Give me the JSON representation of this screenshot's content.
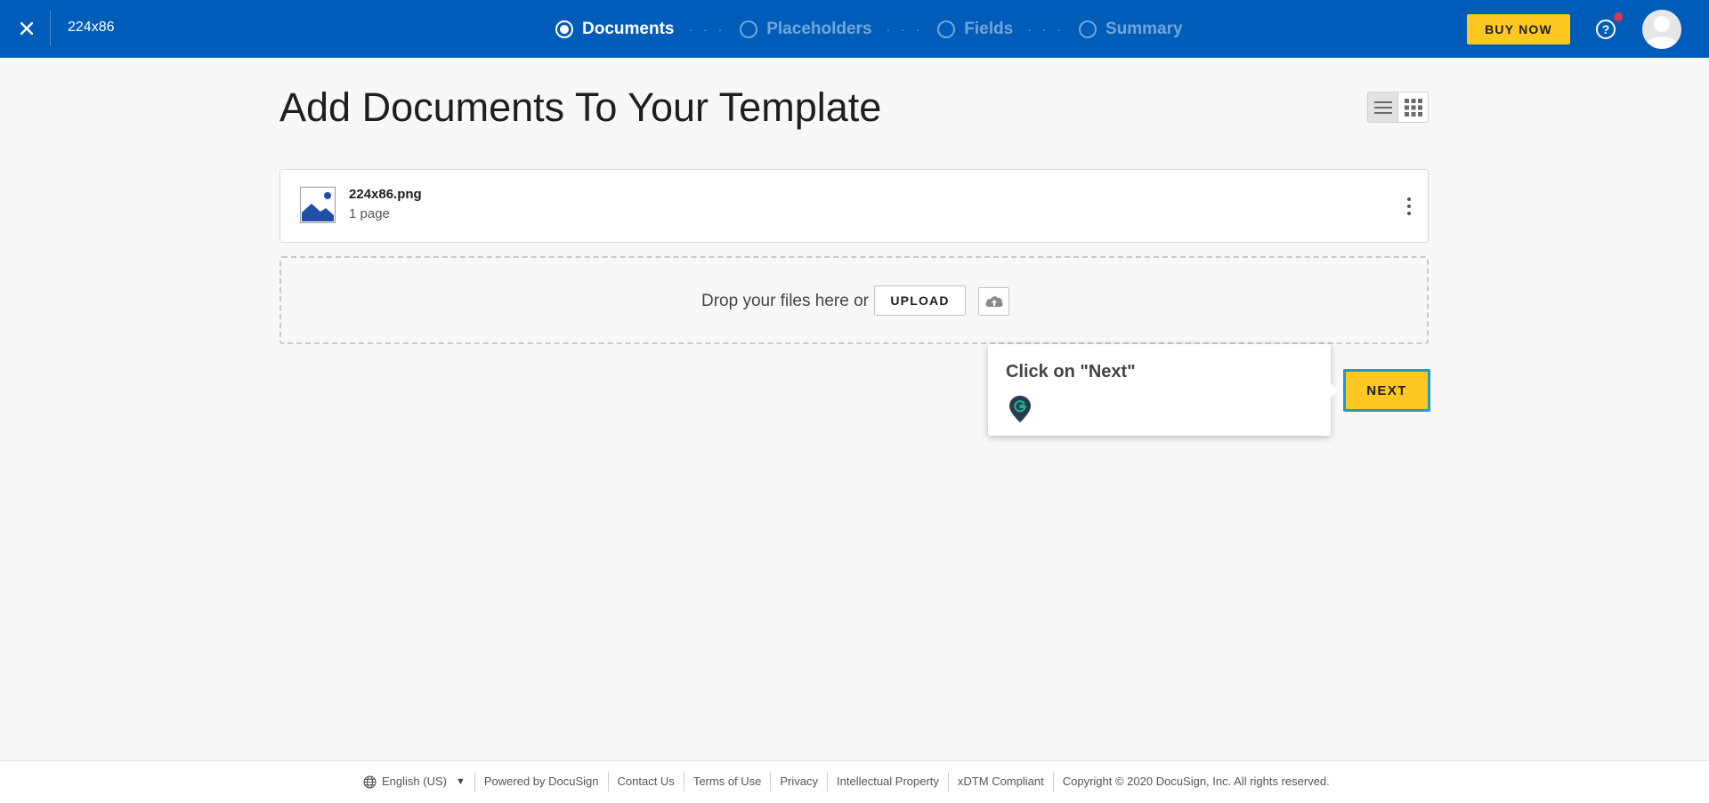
{
  "header": {
    "document_title": "224x86",
    "steps": [
      {
        "label": "Documents",
        "active": true
      },
      {
        "label": "Placeholders",
        "active": false
      },
      {
        "label": "Fields",
        "active": false
      },
      {
        "label": "Summary",
        "active": false
      }
    ],
    "step_separator": "· · ·",
    "buy_now_label": "BUY NOW",
    "help_label": "?",
    "brand_color": "#005cb9",
    "accent_color": "#ffc820",
    "notification_color": "#e0344c"
  },
  "main": {
    "title": "Add Documents To Your Template",
    "view_toggle": {
      "active": "list",
      "options": [
        "list-view-icon",
        "grid-view-icon"
      ]
    },
    "documents": [
      {
        "name": "224x86.png",
        "pages": "1 page",
        "icon": "image-file-icon"
      }
    ],
    "dropzone": {
      "text": "Drop your files here or",
      "upload_label": "UPLOAD",
      "cloud_icon": "cloud-upload-icon"
    },
    "tooltip": {
      "text": "Click on \"Next\"",
      "icon": "guide-pin-icon"
    },
    "next_label": "NEXT"
  },
  "footer": {
    "language": "English (US)",
    "links": [
      "Powered by DocuSign",
      "Contact Us",
      "Terms of Use",
      "Privacy",
      "Intellectual Property",
      "xDTM Compliant"
    ],
    "copyright": "Copyright © 2020 DocuSign, Inc. All rights reserved."
  }
}
